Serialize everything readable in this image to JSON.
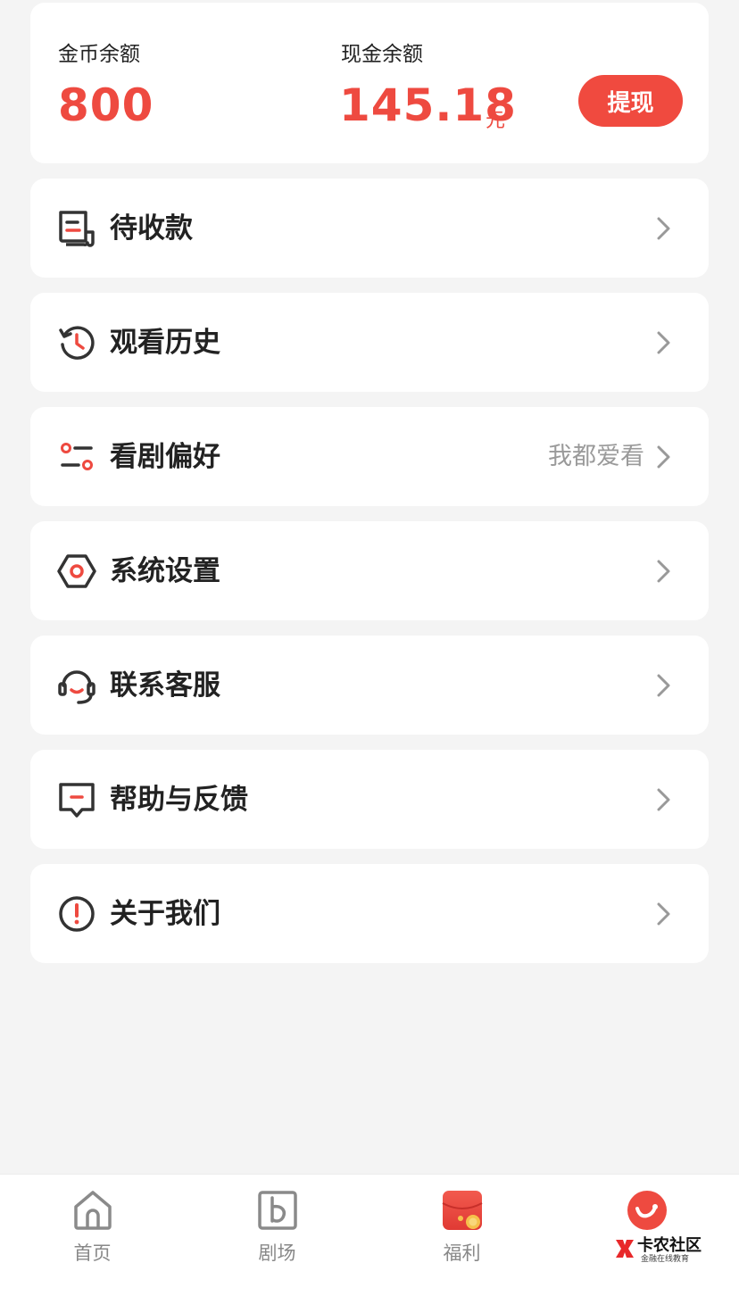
{
  "balance": {
    "coin_label": "金币余额",
    "coin_value": "800",
    "cash_label": "现金余额",
    "cash_value": "145.18",
    "cash_unit": "元",
    "withdraw_label": "提现"
  },
  "menu": [
    {
      "label": "待收款",
      "icon": "receipt-icon",
      "value": ""
    },
    {
      "label": "观看历史",
      "icon": "history-icon",
      "value": ""
    },
    {
      "label": "看剧偏好",
      "icon": "preference-sliders-icon",
      "value": "我都爱看"
    },
    {
      "label": "系统设置",
      "icon": "settings-hexagon-icon",
      "value": ""
    },
    {
      "label": "联系客服",
      "icon": "headset-icon",
      "value": ""
    },
    {
      "label": "帮助与反馈",
      "icon": "feedback-message-icon",
      "value": ""
    },
    {
      "label": "关于我们",
      "icon": "info-exclamation-icon",
      "value": ""
    }
  ],
  "tabbar": {
    "items": [
      {
        "label": "首页",
        "icon": "home-icon"
      },
      {
        "label": "剧场",
        "icon": "theater-icon"
      },
      {
        "label": "福利",
        "icon": "red-envelope-icon"
      },
      {
        "label": "",
        "icon": "profile-avatar-icon"
      }
    ]
  },
  "watermark": {
    "title": "卡农社区",
    "subtitle": "金融在线教育"
  },
  "colors": {
    "accent": "#ee4a40",
    "background": "#f4f4f4",
    "card": "#ffffff",
    "text": "#222222",
    "muted": "#9a9a9a"
  }
}
